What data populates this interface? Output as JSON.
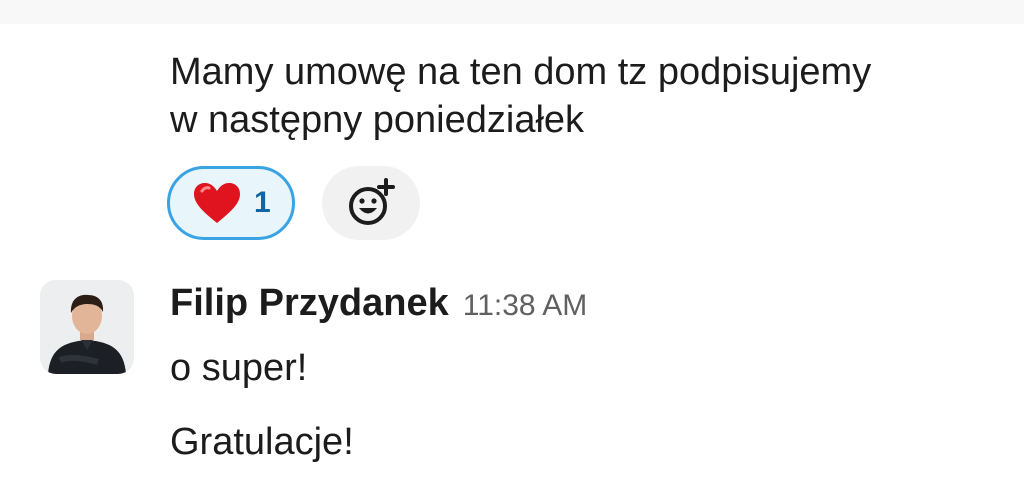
{
  "previous_message": {
    "lines": [
      "Mamy umowę na ten dom tz podpisujemy",
      "w następny poniedziałek"
    ]
  },
  "reactions": [
    {
      "emoji": "heart",
      "count": "1",
      "selected": true
    }
  ],
  "add_reaction": {
    "icon": "add-emoji-icon"
  },
  "message": {
    "sender": "Filip Przydanek",
    "timestamp": "11:38 AM",
    "lines": [
      "o super!",
      "Gratulacje!"
    ]
  },
  "colors": {
    "reaction_border": "#3aa3e3",
    "reaction_bg": "#e8f5fa",
    "reaction_count": "#1264a3",
    "heart": "#e0141e",
    "text": "#1d1c1d",
    "timestamp": "#616061"
  }
}
